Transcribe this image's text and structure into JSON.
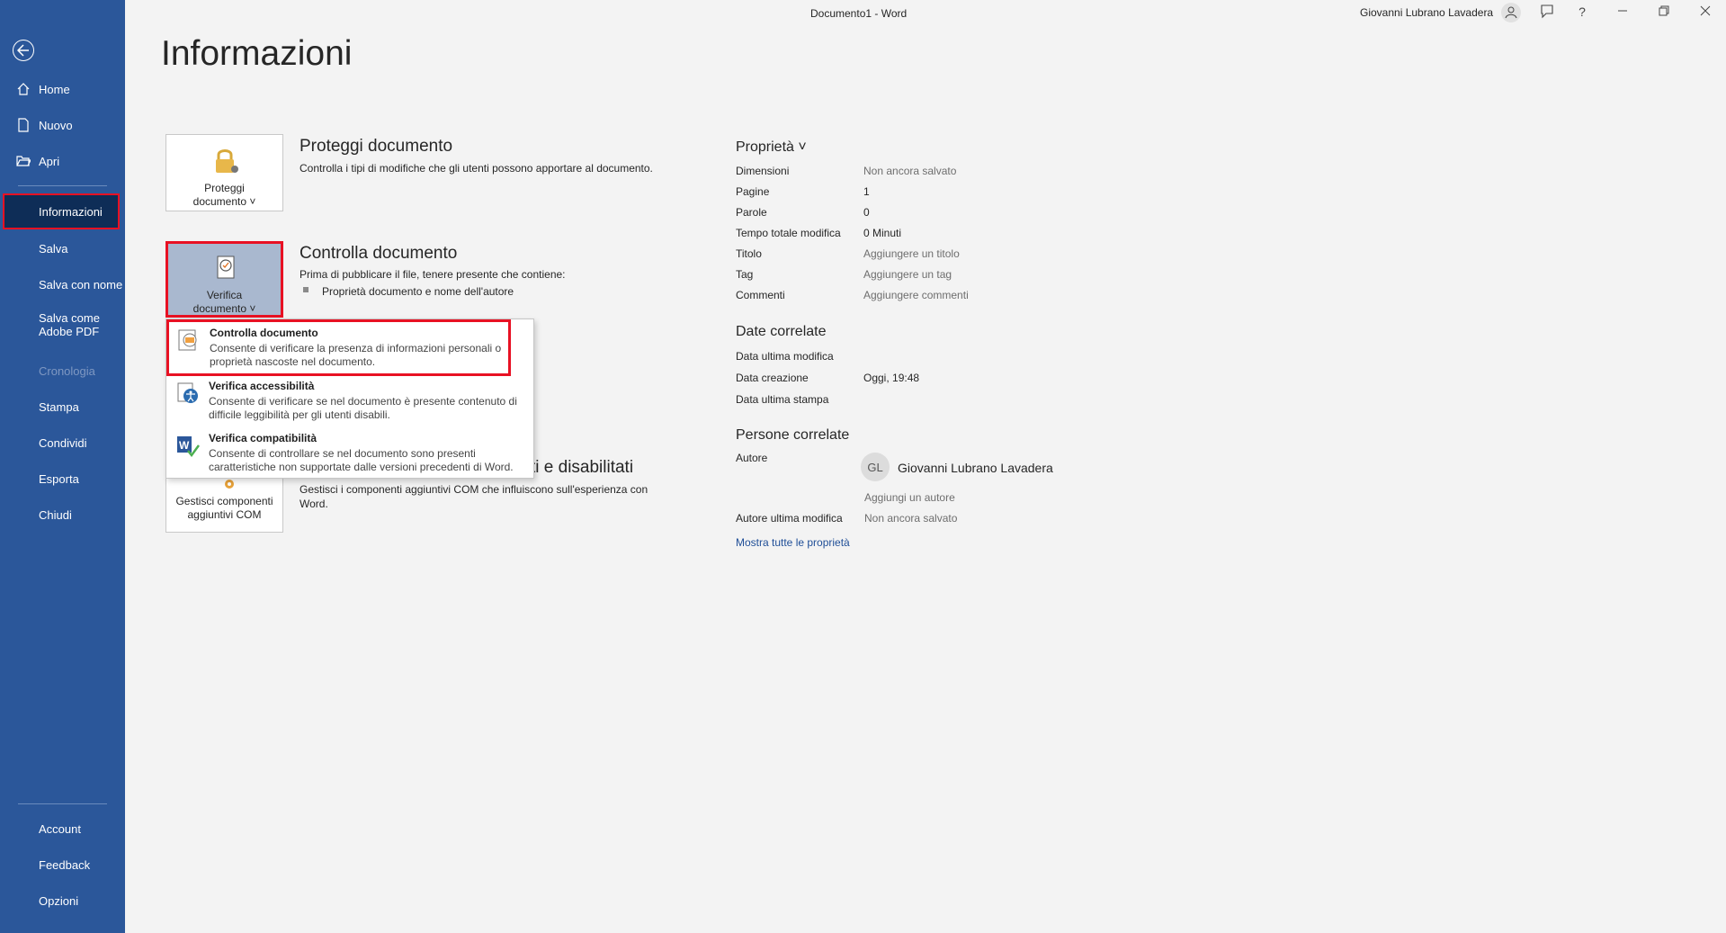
{
  "window": {
    "title": "Documento1  -  Word",
    "user": "Giovanni Lubrano Lavadera"
  },
  "sidebar": {
    "items": [
      {
        "label": "Home"
      },
      {
        "label": "Nuovo"
      },
      {
        "label": "Apri"
      },
      {
        "label": "Informazioni"
      },
      {
        "label": "Salva"
      },
      {
        "label": "Salva con nome"
      },
      {
        "label": "Salva come\nAdobe PDF"
      },
      {
        "label": "Cronologia"
      },
      {
        "label": "Stampa"
      },
      {
        "label": "Condividi"
      },
      {
        "label": "Esporta"
      },
      {
        "label": "Chiudi"
      }
    ],
    "bottom": [
      {
        "label": "Account"
      },
      {
        "label": "Feedback"
      },
      {
        "label": "Opzioni"
      }
    ]
  },
  "page": {
    "title": "Informazioni"
  },
  "protect": {
    "button": "Proteggi\ndocumento ˅",
    "title": "Proteggi documento",
    "desc": "Controlla i tipi di modifiche che gli utenti possono apportare al documento."
  },
  "inspect": {
    "button": "Verifica\ndocumento ˅",
    "title": "Controlla documento",
    "desc": "Prima di pubblicare il file, tenere presente che contiene:",
    "bullet": "Proprietà documento e nome dell'autore"
  },
  "addins": {
    "button": "Gestisci componenti\naggiuntivi COM",
    "title_tail": "ti e disabilitati",
    "desc": "Gestisci i componenti aggiuntivi COM che influiscono sull'esperienza con Word."
  },
  "dropdown": {
    "items": [
      {
        "title": "Controlla documento",
        "desc": "Consente di verificare la presenza di informazioni personali o proprietà nascoste nel documento."
      },
      {
        "title": "Verifica accessibilità",
        "desc": "Consente di verificare se nel documento è presente contenuto di difficile leggibilità per gli utenti disabili."
      },
      {
        "title": "Verifica compatibilità",
        "desc": "Consente di controllare se nel documento sono presenti caratteristiche non supportate dalle versioni precedenti di Word."
      }
    ]
  },
  "properties": {
    "header": "Proprietà ˅",
    "rows": [
      {
        "k": "Dimensioni",
        "v": "Non ancora salvato"
      },
      {
        "k": "Pagine",
        "v": "1"
      },
      {
        "k": "Parole",
        "v": "0"
      },
      {
        "k": "Tempo totale modifica",
        "v": "0 Minuti"
      },
      {
        "k": "Titolo",
        "v": "Aggiungere un titolo"
      },
      {
        "k": "Tag",
        "v": "Aggiungere un tag"
      },
      {
        "k": "Commenti",
        "v": "Aggiungere commenti"
      }
    ]
  },
  "dates": {
    "header": "Date correlate",
    "rows": [
      {
        "k": "Data ultima modifica",
        "v": ""
      },
      {
        "k": "Data creazione",
        "v": "Oggi, 19:48"
      },
      {
        "k": "Data ultima stampa",
        "v": ""
      }
    ]
  },
  "people": {
    "header": "Persone correlate",
    "author_label": "Autore",
    "author_initials": "GL",
    "author_name": "Giovanni Lubrano Lavadera",
    "add_author": "Aggiungi un autore",
    "last_mod_label": "Autore ultima modifica",
    "last_mod_value": "Non ancora salvato",
    "show_all": "Mostra tutte le proprietà"
  },
  "colors": {
    "sidebar": "#2b579a",
    "active": "#0e2d57",
    "highlight": "#e81123",
    "link": "#1f4e97"
  },
  "icons": [
    "back-arrow-icon",
    "home-icon",
    "new-doc-icon",
    "open-folder-icon",
    "lock-icon",
    "inspect-icon",
    "addin-gear-icon",
    "person-icon",
    "feedback-icon",
    "help-icon",
    "minimize-icon",
    "restore-icon",
    "close-icon"
  ]
}
